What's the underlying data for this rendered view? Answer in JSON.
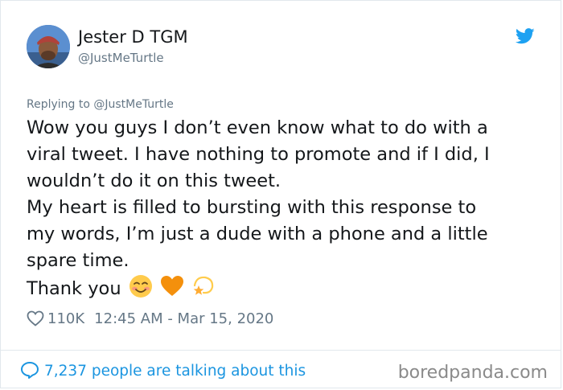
{
  "author": {
    "display_name": "Jester D TGM",
    "handle": "@JustMeTurtle"
  },
  "icons": {
    "platform": "twitter-bird-icon",
    "like": "heart-icon",
    "reply": "speech-bubble-icon",
    "emojis": [
      "smiling-face-with-blush-emoji",
      "orange-heart-emoji",
      "dizzy-star-emoji"
    ]
  },
  "reply_context": "Replying to @JustMeTurtle",
  "tweet": {
    "lines": [
      "Wow you guys I don’t even know what to do with a",
      "viral tweet. I have nothing to promote and if I did, I",
      "wouldn’t do it on this tweet.",
      "My heart is filled to bursting with this response to",
      "my words, I’m just a dude with a phone and a little",
      "spare time.",
      "Thank you"
    ]
  },
  "stats": {
    "likes": "110K",
    "timestamp": "12:45 AM - Mar 15, 2020"
  },
  "footer": {
    "talking": "7,237 people are talking about this"
  },
  "watermark": "boredpanda.com",
  "colors": {
    "link_blue": "#1b95e0",
    "twitter_blue": "#1da1f2",
    "muted_gray": "#657786",
    "text": "#14171a"
  }
}
